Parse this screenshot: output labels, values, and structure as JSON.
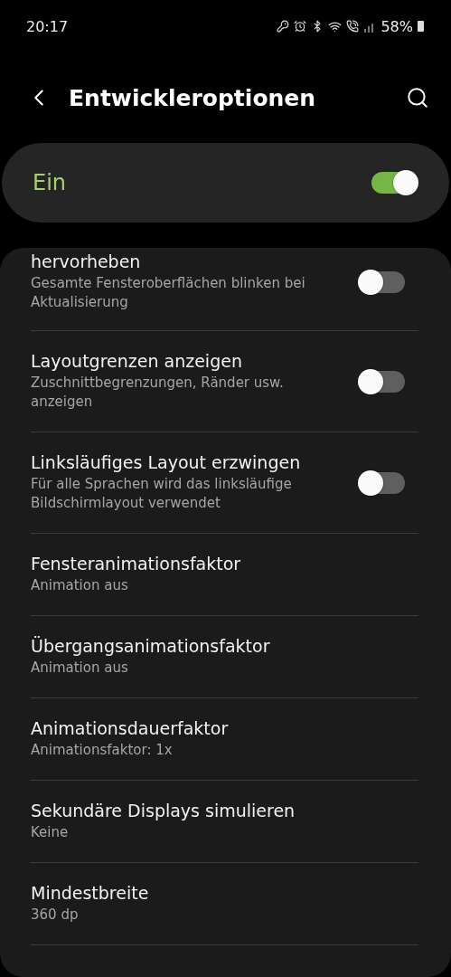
{
  "status_bar": {
    "time": "20:17",
    "battery": "58%"
  },
  "header": {
    "title": "Entwickleroptionen"
  },
  "master_switch": {
    "label": "Ein",
    "on": true
  },
  "items": [
    {
      "kind": "toggle",
      "title": "hervorheben",
      "subtitle": "Gesamte Fensteroberflächen blinken bei Aktualisierung",
      "on": false
    },
    {
      "kind": "toggle",
      "title": "Layoutgrenzen anzeigen",
      "subtitle": "Zuschnittbegrenzungen, Ränder usw. anzeigen",
      "on": false
    },
    {
      "kind": "toggle",
      "title": "Linksläufiges Layout erzwingen",
      "subtitle": "Für alle Sprachen wird das linksläufige Bildschirmlayout verwendet",
      "on": false
    },
    {
      "kind": "value",
      "title": "Fensteranimationsfaktor",
      "subtitle": "Animation aus"
    },
    {
      "kind": "value",
      "title": "Übergangsanimationsfaktor",
      "subtitle": "Animation aus"
    },
    {
      "kind": "value",
      "title": "Animationsdauerfaktor",
      "subtitle": "Animationsfaktor: 1x"
    },
    {
      "kind": "value",
      "title": "Sekundäre Displays simulieren",
      "subtitle": "Keine"
    },
    {
      "kind": "value",
      "title": "Mindestbreite",
      "subtitle": "360 dp"
    }
  ]
}
